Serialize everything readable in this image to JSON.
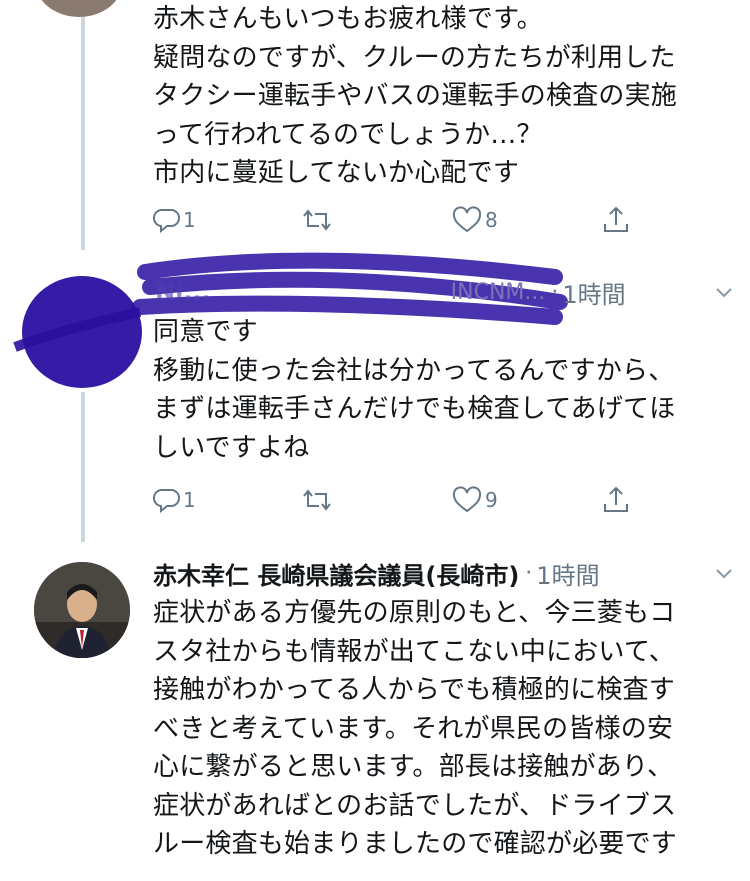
{
  "tweets": [
    {
      "lines": [
        "赤木さんもいつもお疲れ様です。",
        "疑問なのですが、クルーの方たちが利用した",
        "タクシー運転手やバスの運転手の検査の実施",
        "って行われてるのでしょうか…？",
        "市内に蔓延してないか心配です"
      ],
      "reply_count": "1",
      "like_count": "8"
    },
    {
      "name_obscured": "Ni...",
      "handle_visible": "INCNM...",
      "time": "1時間",
      "lines": [
        "同意です",
        "移動に使った会社は分かってるんですから、",
        "まずは運転手さんだけでも検査してあげてほ",
        "しいですよね"
      ],
      "reply_count": "1",
      "like_count": "9"
    },
    {
      "name": "赤木幸仁 長崎県議会議員(長崎市)",
      "time": "1時間",
      "lines": [
        "症状がある方優先の原則のもと、今三菱もコ",
        "スタ社からも情報が出てこない中において、",
        "接触がわかってる人からでも積極的に検査す",
        "べきと考えています。それが県民の皆様の安",
        "心に繋がると思います。部長は接触があり、",
        "症状があればとのお話でしたが、ドライブス",
        "ルー検査も始まりましたので確認が必要です"
      ]
    }
  ],
  "colors": {
    "text": "#14171a",
    "muted": "#657786",
    "thread": "#ccd6dd",
    "scribble": "#2a0fa0"
  },
  "icons": [
    "reply-icon",
    "retweet-icon",
    "like-icon",
    "share-icon",
    "chevron-down-icon"
  ]
}
